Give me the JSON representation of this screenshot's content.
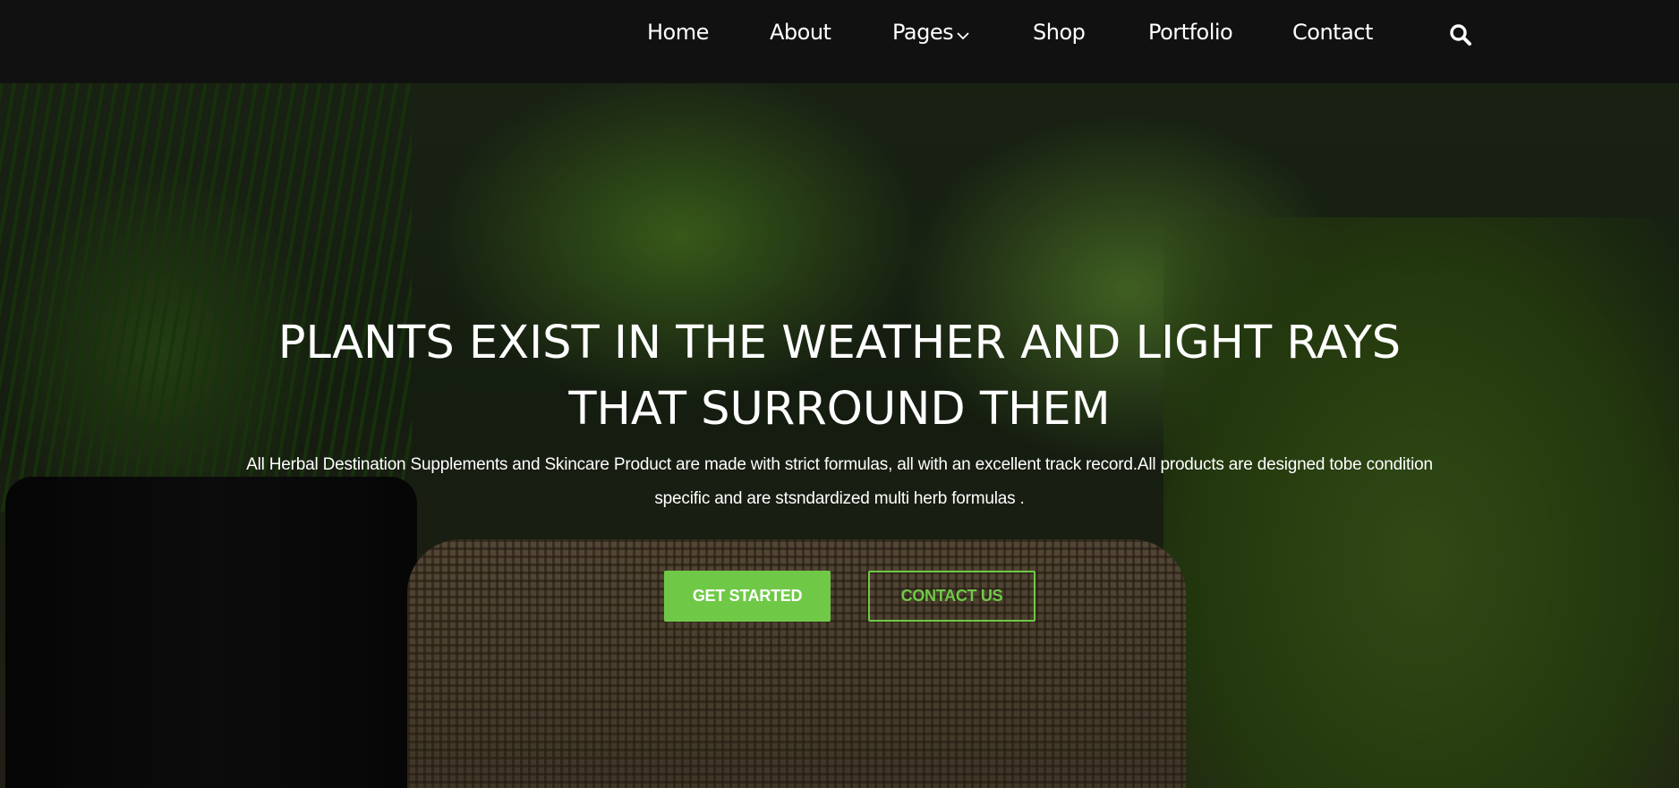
{
  "nav": {
    "items": [
      {
        "label": "Home"
      },
      {
        "label": "About"
      },
      {
        "label": "Pages",
        "has_dropdown": true
      },
      {
        "label": "Shop"
      },
      {
        "label": "Portfolio"
      },
      {
        "label": "Contact"
      }
    ],
    "search_icon": "search-icon"
  },
  "hero": {
    "title": "PLANTS EXIST IN THE WEATHER AND LIGHT RAYS THAT SURROUND THEM",
    "description": "All Herbal Destination Supplements and Skincare Product are made with strict formulas, all with an excellent track record.All products are designed tobe condition specific and are stsndardized multi herb formulas .",
    "primary_button": "GET STARTED",
    "secondary_button": "CONTACT US"
  },
  "colors": {
    "accent": "#6fc947",
    "nav_bg": "#111111",
    "text": "#ffffff"
  }
}
